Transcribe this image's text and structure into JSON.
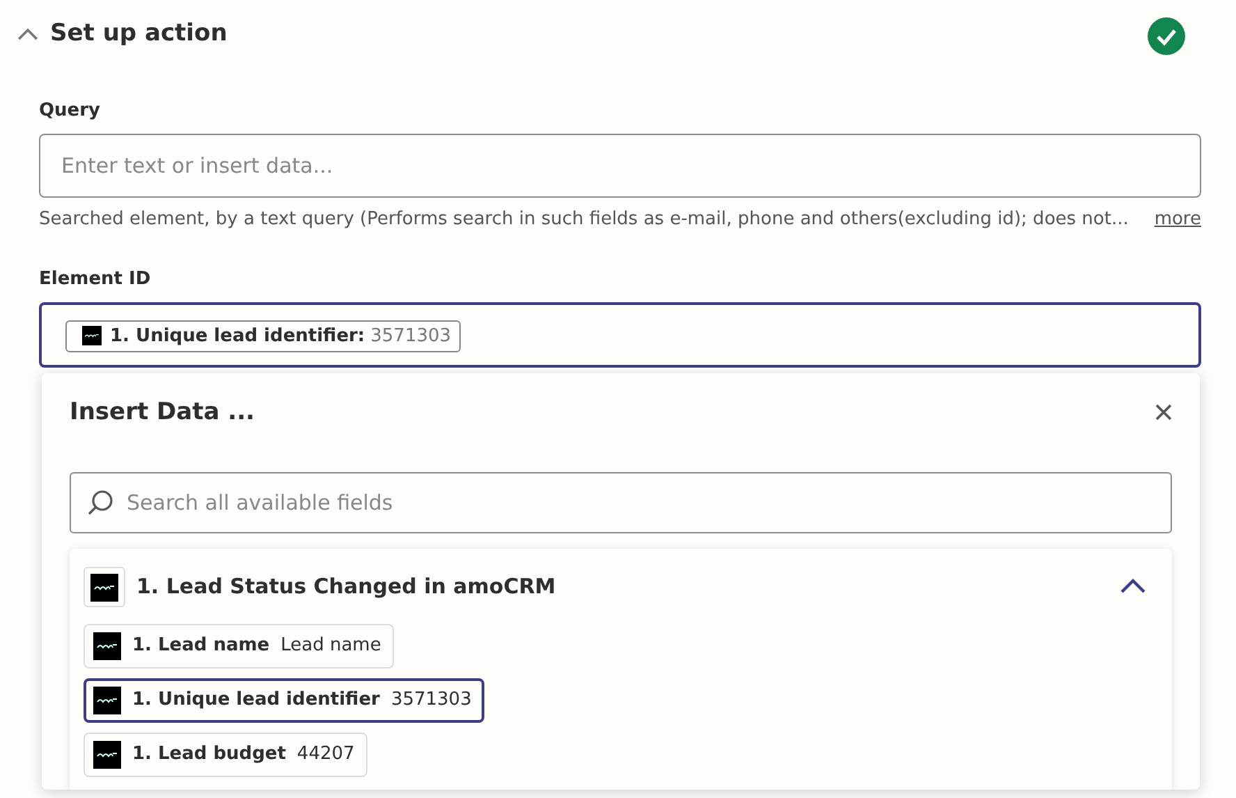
{
  "header": {
    "title": "Set up action",
    "expanded": true,
    "complete": true
  },
  "fields": [
    {
      "label": "Query",
      "placeholder": "Enter text or insert data...",
      "focused": false,
      "help": "Searched element, by a text query (Performs search in such fields as e-mail, phone and others(excluding id); does not...",
      "more": "more"
    },
    {
      "label": "Element ID",
      "focused": true,
      "chip": {
        "label": "1. Unique lead identifier:",
        "value": "3571303"
      }
    }
  ],
  "insert_panel": {
    "title": "Insert Data ...",
    "search_placeholder": "Search all available fields",
    "group": {
      "title": "1. Lead Status Changed in amoCRM",
      "expanded": true,
      "items": [
        {
          "label": "1. Lead name",
          "value": "Lead name",
          "selected": false
        },
        {
          "label": "1. Unique lead identifier",
          "value": "3571303",
          "selected": true
        },
        {
          "label": "1. Lead budget",
          "value": "44207",
          "selected": false
        }
      ]
    }
  }
}
